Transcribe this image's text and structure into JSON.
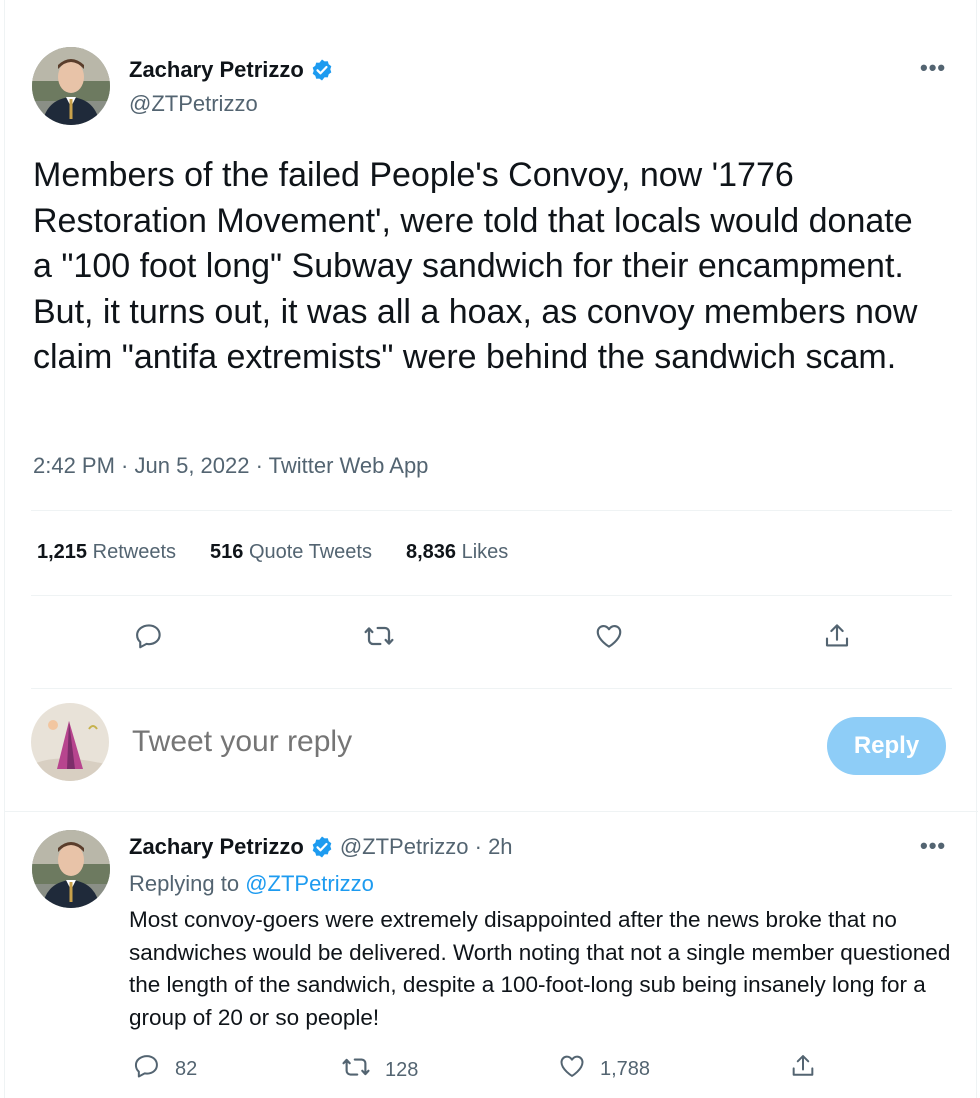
{
  "main_tweet": {
    "author_name": "Zachary Petrizzo",
    "author_handle": "@ZTPetrizzo",
    "text": "Members of the failed People's Convoy, now '1776 Restoration Movement', were told that locals would donate a \"100 foot long\" Subway sandwich for their encampment. But, it turns out, it was all a hoax, as convoy members now claim \"antifa extremists\" were behind the sandwich scam.",
    "time": "2:42 PM",
    "date": "Jun 5, 2022",
    "source": "Twitter Web App",
    "separator": " · ",
    "more_icon": "•••",
    "stats": {
      "retweets_count": "1,215",
      "retweets_label": "Retweets",
      "quotes_count": "516",
      "quotes_label": "Quote Tweets",
      "likes_count": "8,836",
      "likes_label": "Likes"
    }
  },
  "composer": {
    "placeholder": "Tweet your reply",
    "button_label": "Reply"
  },
  "reply_tweet": {
    "author_name": "Zachary Petrizzo",
    "author_handle_time": "@ZTPetrizzo · 2h",
    "replying_prefix": "Replying to ",
    "replying_handle": "@ZTPetrizzo",
    "text": "Most convoy-goers were extremely disappointed after the news broke that no sandwiches would be delivered. Worth noting that not a single member questioned the length of the sandwich, despite a 100-foot-long sub being insanely long for a group of 20 or so people!",
    "more_icon": "•••",
    "reply_count": "82",
    "retweet_count": "128",
    "like_count": "1,788"
  },
  "colors": {
    "accent": "#1d9bf0",
    "muted": "#536471",
    "text": "#0f1419",
    "reply_button_disabled": "#8ecdf7",
    "divider": "#eff3f4"
  },
  "icons": [
    "verified-badge-icon",
    "reply-icon",
    "retweet-icon",
    "like-icon",
    "share-icon",
    "more-icon"
  ]
}
